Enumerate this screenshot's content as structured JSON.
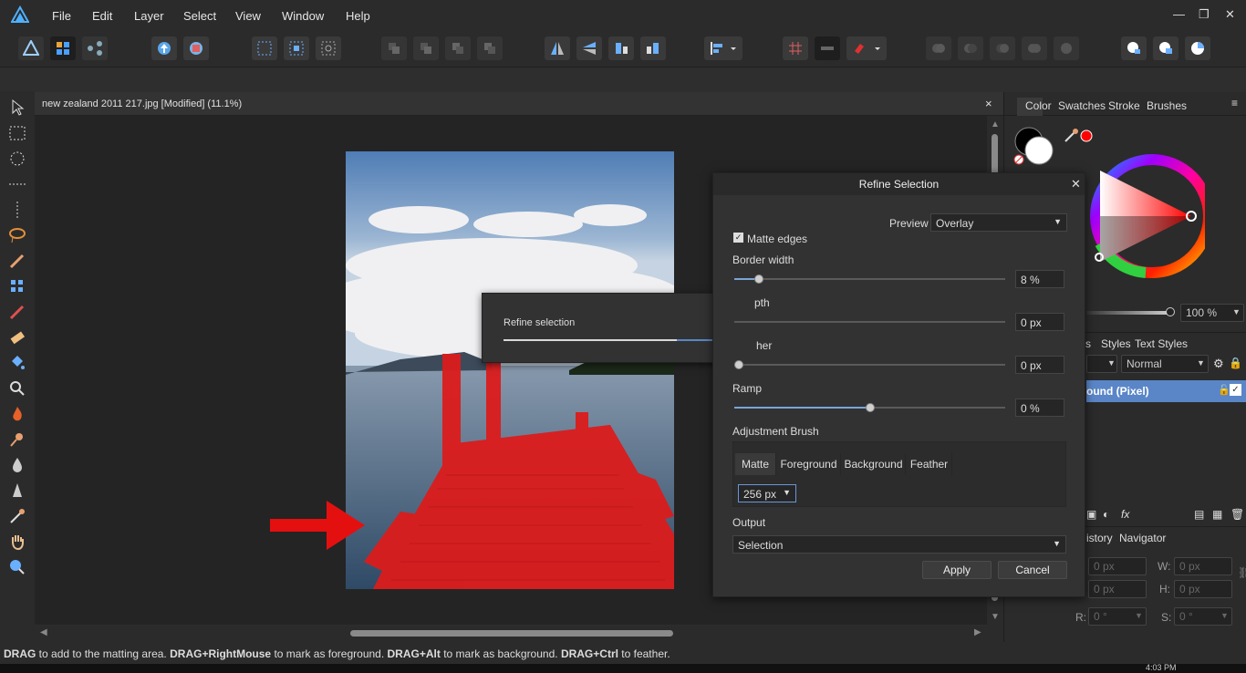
{
  "menu": [
    "File",
    "Edit",
    "Layer",
    "Select",
    "View",
    "Window",
    "Help"
  ],
  "window_controls": {
    "minimize": "—",
    "restore": "❐",
    "close": "✕"
  },
  "document": {
    "tab_title": "new zealand 2011 217.jpg [Modified] (11.1%)",
    "close": "×"
  },
  "right_panel": {
    "tabs": [
      "Color",
      "Swatches",
      "Stroke",
      "Brushes"
    ],
    "opacity": "100 %",
    "layers_tabs": [
      "s",
      "Styles",
      "Text Styles"
    ],
    "blend_mode": "Normal",
    "layer_name": "ound (Pixel)",
    "history_tabs": [
      "istory",
      "Navigator"
    ],
    "transform": {
      "x": "0 px",
      "y": "0 px",
      "w_label": "W:",
      "w": "0 px",
      "h_label": "H:",
      "h": "0 px",
      "r_label": "R:",
      "r": "0 °",
      "s_label": "S:",
      "s": "0 °"
    }
  },
  "refine_dialog": {
    "title": "Refine Selection",
    "close": "✕",
    "preview_label": "Preview",
    "preview_value": "Overlay",
    "matte_edges": "Matte edges",
    "border_width_label": "Border width",
    "border_width_value": "8 %",
    "border_width_level": 0.09,
    "smooth_label": "pth",
    "smooth_value": "0 px",
    "feather_label": "her",
    "feather_value": "0 px",
    "ramp_label": "Ramp",
    "ramp_value": "0 %",
    "ramp_level": 0.5,
    "adjustment_brush_label": "Adjustment Brush",
    "brush_modes": [
      "Matte",
      "Foreground",
      "Background",
      "Feather"
    ],
    "brush_size": "256 px",
    "output_label": "Output",
    "output_value": "Selection",
    "apply": "Apply",
    "cancel": "Cancel"
  },
  "progress_popup": {
    "label": "Refine selection",
    "progress": 0.75
  },
  "status_bar": [
    {
      "bold": "DRAG",
      "text": " to add to the matting area. "
    },
    {
      "bold": "DRAG+RightMouse",
      "text": " to mark as foreground. "
    },
    {
      "bold": "DRAG+Alt",
      "text": " to mark as background. "
    },
    {
      "bold": "DRAG+Ctrl",
      "text": " to feather."
    }
  ],
  "taskbar_time": "4:03 PM",
  "colors": {
    "accent_blue": "#5b8fd6",
    "selection_red": "#e01b1b",
    "primary_color": "#ff0000"
  }
}
